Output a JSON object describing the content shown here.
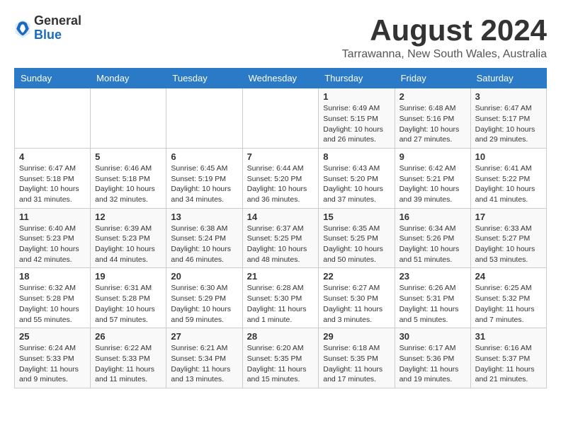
{
  "logo": {
    "general": "General",
    "blue": "Blue"
  },
  "header": {
    "title": "August 2024",
    "subtitle": "Tarrawanna, New South Wales, Australia"
  },
  "calendar": {
    "weekdays": [
      "Sunday",
      "Monday",
      "Tuesday",
      "Wednesday",
      "Thursday",
      "Friday",
      "Saturday"
    ],
    "weeks": [
      [
        {
          "day": "",
          "info": ""
        },
        {
          "day": "",
          "info": ""
        },
        {
          "day": "",
          "info": ""
        },
        {
          "day": "",
          "info": ""
        },
        {
          "day": "1",
          "info": "Sunrise: 6:49 AM\nSunset: 5:15 PM\nDaylight: 10 hours and 26 minutes."
        },
        {
          "day": "2",
          "info": "Sunrise: 6:48 AM\nSunset: 5:16 PM\nDaylight: 10 hours and 27 minutes."
        },
        {
          "day": "3",
          "info": "Sunrise: 6:47 AM\nSunset: 5:17 PM\nDaylight: 10 hours and 29 minutes."
        }
      ],
      [
        {
          "day": "4",
          "info": "Sunrise: 6:47 AM\nSunset: 5:18 PM\nDaylight: 10 hours and 31 minutes."
        },
        {
          "day": "5",
          "info": "Sunrise: 6:46 AM\nSunset: 5:18 PM\nDaylight: 10 hours and 32 minutes."
        },
        {
          "day": "6",
          "info": "Sunrise: 6:45 AM\nSunset: 5:19 PM\nDaylight: 10 hours and 34 minutes."
        },
        {
          "day": "7",
          "info": "Sunrise: 6:44 AM\nSunset: 5:20 PM\nDaylight: 10 hours and 36 minutes."
        },
        {
          "day": "8",
          "info": "Sunrise: 6:43 AM\nSunset: 5:20 PM\nDaylight: 10 hours and 37 minutes."
        },
        {
          "day": "9",
          "info": "Sunrise: 6:42 AM\nSunset: 5:21 PM\nDaylight: 10 hours and 39 minutes."
        },
        {
          "day": "10",
          "info": "Sunrise: 6:41 AM\nSunset: 5:22 PM\nDaylight: 10 hours and 41 minutes."
        }
      ],
      [
        {
          "day": "11",
          "info": "Sunrise: 6:40 AM\nSunset: 5:23 PM\nDaylight: 10 hours and 42 minutes."
        },
        {
          "day": "12",
          "info": "Sunrise: 6:39 AM\nSunset: 5:23 PM\nDaylight: 10 hours and 44 minutes."
        },
        {
          "day": "13",
          "info": "Sunrise: 6:38 AM\nSunset: 5:24 PM\nDaylight: 10 hours and 46 minutes."
        },
        {
          "day": "14",
          "info": "Sunrise: 6:37 AM\nSunset: 5:25 PM\nDaylight: 10 hours and 48 minutes."
        },
        {
          "day": "15",
          "info": "Sunrise: 6:35 AM\nSunset: 5:25 PM\nDaylight: 10 hours and 50 minutes."
        },
        {
          "day": "16",
          "info": "Sunrise: 6:34 AM\nSunset: 5:26 PM\nDaylight: 10 hours and 51 minutes."
        },
        {
          "day": "17",
          "info": "Sunrise: 6:33 AM\nSunset: 5:27 PM\nDaylight: 10 hours and 53 minutes."
        }
      ],
      [
        {
          "day": "18",
          "info": "Sunrise: 6:32 AM\nSunset: 5:28 PM\nDaylight: 10 hours and 55 minutes."
        },
        {
          "day": "19",
          "info": "Sunrise: 6:31 AM\nSunset: 5:28 PM\nDaylight: 10 hours and 57 minutes."
        },
        {
          "day": "20",
          "info": "Sunrise: 6:30 AM\nSunset: 5:29 PM\nDaylight: 10 hours and 59 minutes."
        },
        {
          "day": "21",
          "info": "Sunrise: 6:28 AM\nSunset: 5:30 PM\nDaylight: 11 hours and 1 minute."
        },
        {
          "day": "22",
          "info": "Sunrise: 6:27 AM\nSunset: 5:30 PM\nDaylight: 11 hours and 3 minutes."
        },
        {
          "day": "23",
          "info": "Sunrise: 6:26 AM\nSunset: 5:31 PM\nDaylight: 11 hours and 5 minutes."
        },
        {
          "day": "24",
          "info": "Sunrise: 6:25 AM\nSunset: 5:32 PM\nDaylight: 11 hours and 7 minutes."
        }
      ],
      [
        {
          "day": "25",
          "info": "Sunrise: 6:24 AM\nSunset: 5:33 PM\nDaylight: 11 hours and 9 minutes."
        },
        {
          "day": "26",
          "info": "Sunrise: 6:22 AM\nSunset: 5:33 PM\nDaylight: 11 hours and 11 minutes."
        },
        {
          "day": "27",
          "info": "Sunrise: 6:21 AM\nSunset: 5:34 PM\nDaylight: 11 hours and 13 minutes."
        },
        {
          "day": "28",
          "info": "Sunrise: 6:20 AM\nSunset: 5:35 PM\nDaylight: 11 hours and 15 minutes."
        },
        {
          "day": "29",
          "info": "Sunrise: 6:18 AM\nSunset: 5:35 PM\nDaylight: 11 hours and 17 minutes."
        },
        {
          "day": "30",
          "info": "Sunrise: 6:17 AM\nSunset: 5:36 PM\nDaylight: 11 hours and 19 minutes."
        },
        {
          "day": "31",
          "info": "Sunrise: 6:16 AM\nSunset: 5:37 PM\nDaylight: 11 hours and 21 minutes."
        }
      ]
    ]
  }
}
